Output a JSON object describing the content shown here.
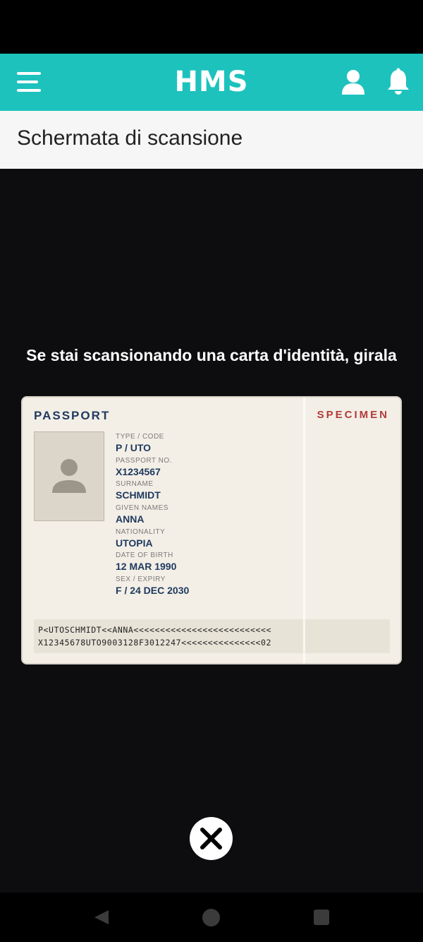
{
  "app_bar": {
    "logo": "HMS",
    "accent_color": "#1dc2bd",
    "icons": {
      "menu": "hamburger-menu-icon",
      "user": "user-icon",
      "notifications": "bell-icon"
    }
  },
  "header": {
    "title": "Schermata di scansione"
  },
  "scan": {
    "instruction": "Se stai scansionando una carta d'identità, girala"
  },
  "passport": {
    "heading": "PASSPORT",
    "specimen": "SPECIMEN",
    "fields": [
      {
        "label": "TYPE / CODE",
        "value": "P / UTO"
      },
      {
        "label": "PASSPORT NO.",
        "value": "X1234567"
      },
      {
        "label": "SURNAME",
        "value": "SCHMIDT"
      },
      {
        "label": "GIVEN NAMES",
        "value": "ANNA"
      },
      {
        "label": "NATIONALITY",
        "value": "UTOPIA"
      },
      {
        "label": "DATE OF BIRTH",
        "value": "12 MAR 1990"
      },
      {
        "label": "SEX / EXPIRY",
        "value": "F / 24 DEC 2030"
      }
    ],
    "mrz_line1": "P<UTOSCHMIDT<<ANNA<<<<<<<<<<<<<<<<<<<<<<<<<<",
    "mrz_line2": "X12345678UTO9003128F3012247<<<<<<<<<<<<<<<02"
  },
  "controls": {
    "close_icon": "close-icon"
  },
  "nav": {
    "back_icon": "back-triangle-icon",
    "home_icon": "home-circle-icon",
    "recent_icon": "recent-apps-icon"
  }
}
